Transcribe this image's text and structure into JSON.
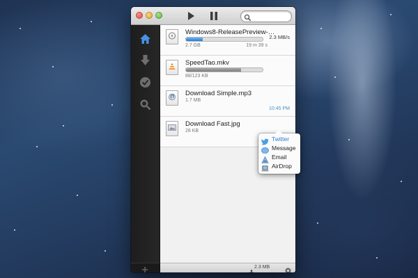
{
  "toolbar": {
    "play_icon": "play-icon",
    "pause_icon": "pause-icon",
    "search_icon": "search-icon",
    "search_value": ""
  },
  "sidebar": {
    "items": [
      {
        "icon": "home-icon",
        "active": true,
        "color": "#4a90e2"
      },
      {
        "icon": "download-arrow-icon",
        "active": false
      },
      {
        "icon": "checkmark-icon",
        "active": false
      },
      {
        "icon": "magnifier-icon",
        "active": false
      }
    ],
    "footer_icon": "add-icon"
  },
  "downloads": [
    {
      "name": "Windows8-ReleasePreview-…",
      "size": "2.7 GB",
      "remaining": "19 m 39 s",
      "rate": "2.3 MB/s",
      "progress": 0.22,
      "bar_color": "blue",
      "icon": "disc-image-icon"
    },
    {
      "name": "SpeedTao.mkv",
      "size": "88/123 KB",
      "progress": 0.72,
      "bar_color": "gray",
      "icon": "vlc-cone-icon"
    },
    {
      "name": "Download Simple.mp3",
      "size": "1.7 MB",
      "completed_time": "10:45 PM",
      "icon": "audio-file-icon"
    },
    {
      "name": "Download Fast.jpg",
      "size": "28 KB",
      "icon": "image-file-icon",
      "actions": [
        "reveal-icon",
        "share-icon",
        "remove-icon"
      ]
    }
  ],
  "share_menu": {
    "items": [
      {
        "label": "Twitter",
        "icon": "twitter-bird-icon",
        "active": true
      },
      {
        "label": "Message",
        "icon": "message-bubble-icon",
        "active": false
      },
      {
        "label": "Email",
        "icon": "email-stamp-icon",
        "active": false
      },
      {
        "label": "AirDrop",
        "icon": "airdrop-icon",
        "active": false
      }
    ]
  },
  "status": {
    "total_speed": "2.3 MB",
    "speed_icon": "download-speed-icon",
    "settings_icon": "gear-icon"
  },
  "colors": {
    "accent": "#2a7bd6",
    "completed_time": "#4a90c8",
    "sidebar_bg": "#1d1d1d"
  }
}
